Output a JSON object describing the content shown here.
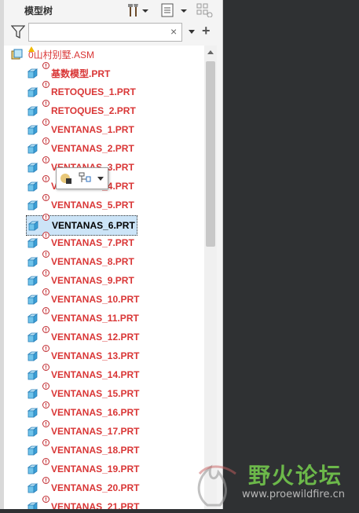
{
  "panel": {
    "title": "模型树",
    "search_value": "",
    "clear_symbol": "×",
    "add_symbol": "+"
  },
  "tree": {
    "root": "0山村别墅.ASM",
    "items": [
      {
        "label": "基数模型.PRT",
        "warn": true
      },
      {
        "label": "RETOQUES_1.PRT",
        "warn": true
      },
      {
        "label": "RETOQUES_2.PRT",
        "warn": true
      },
      {
        "label": "VENTANAS_1.PRT",
        "warn": true
      },
      {
        "label": "VENTANAS_2.PRT",
        "warn": true
      },
      {
        "label": "VENTANAS_3.PRT",
        "warn": true
      },
      {
        "label": "VENTANAS_4.PRT",
        "warn": true
      },
      {
        "label": "VENTANAS_5.PRT",
        "warn": true
      },
      {
        "label": "VENTANAS_6.PRT",
        "warn": true,
        "selected": true
      },
      {
        "label": "VENTANAS_7.PRT",
        "warn": true
      },
      {
        "label": "VENTANAS_8.PRT",
        "warn": true
      },
      {
        "label": "VENTANAS_9.PRT",
        "warn": true
      },
      {
        "label": "VENTANAS_10.PRT",
        "warn": true
      },
      {
        "label": "VENTANAS_11.PRT",
        "warn": true
      },
      {
        "label": "VENTANAS_12.PRT",
        "warn": true
      },
      {
        "label": "VENTANAS_13.PRT",
        "warn": true
      },
      {
        "label": "VENTANAS_14.PRT",
        "warn": true
      },
      {
        "label": "VENTANAS_15.PRT",
        "warn": true
      },
      {
        "label": "VENTANAS_16.PRT",
        "warn": true
      },
      {
        "label": "VENTANAS_17.PRT",
        "warn": true
      },
      {
        "label": "VENTANAS_18.PRT",
        "warn": true
      },
      {
        "label": "VENTANAS_19.PRT",
        "warn": true
      },
      {
        "label": "VENTANAS_20.PRT",
        "warn": true
      },
      {
        "label": "VENTANAS_21.PRT",
        "warn": true
      }
    ]
  },
  "watermark": {
    "cn": "野火论坛",
    "url": "www.proewildfire.cn"
  },
  "colors": {
    "item_text": "#d93636",
    "selected_bg": "#cce4f7",
    "right_bg": "#2f3133",
    "watermark_green": "#6cb84a"
  },
  "icons": [
    "settings-tools-icon",
    "show-tree-options-icon",
    "tree-columns-icon",
    "filter-icon",
    "part-cube-icon",
    "assembly-icon",
    "warning-icon",
    "appearance-icon",
    "edit-definition-icon"
  ]
}
